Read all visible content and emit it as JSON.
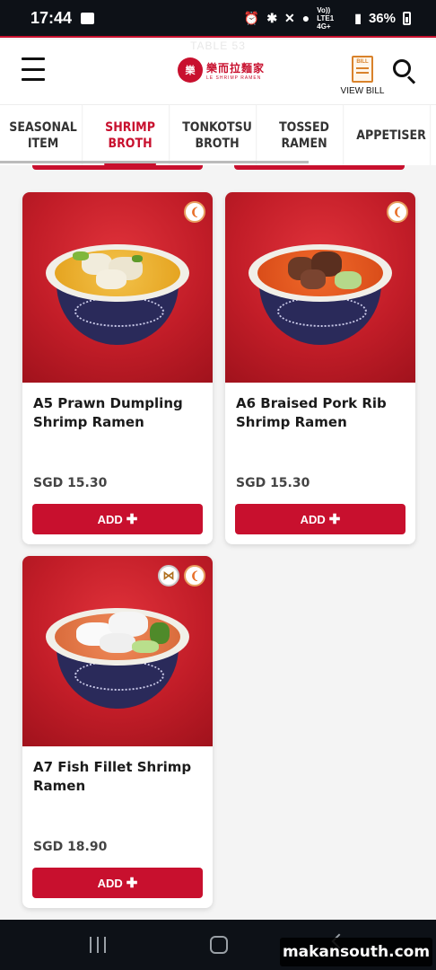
{
  "status_bar": {
    "time": "17:44",
    "network": "Vo)) LTE1 4G+",
    "battery": "36%"
  },
  "header": {
    "table_label": "TABLE 53",
    "logo_main": "樂而拉麵家",
    "logo_sub": "LE SHRIMP RAMEN",
    "logo_mark": "樂",
    "bill_icon_text": "BILL",
    "view_bill_label": "VIEW BILL"
  },
  "tabs": [
    {
      "label": "SEASONAL ITEM",
      "active": false
    },
    {
      "label": "SHRIMP BROTH",
      "active": true
    },
    {
      "label": "TONKOTSU BROTH",
      "active": false
    },
    {
      "label": "TOSSED RAMEN",
      "active": false
    },
    {
      "label": "APPETISER",
      "active": false
    }
  ],
  "menu_items": [
    {
      "name": "A5 Prawn Dumpling Shrimp Ramen",
      "price": "SGD 15.30",
      "add_label": "ADD",
      "badges": [
        "shrimp-icon"
      ]
    },
    {
      "name": "A6 Braised Pork Rib Shrimp Ramen",
      "price": "SGD 15.30",
      "add_label": "ADD",
      "badges": [
        "shrimp-icon"
      ]
    },
    {
      "name": "A7 Fish Fillet Shrimp Ramen",
      "price": "SGD 18.90",
      "add_label": "ADD",
      "badges": [
        "fish-icon",
        "shrimp-icon"
      ]
    }
  ],
  "watermark": "makansouth.com",
  "colors": {
    "brand": "#c8102e",
    "bill_accent": "#d9822b"
  }
}
